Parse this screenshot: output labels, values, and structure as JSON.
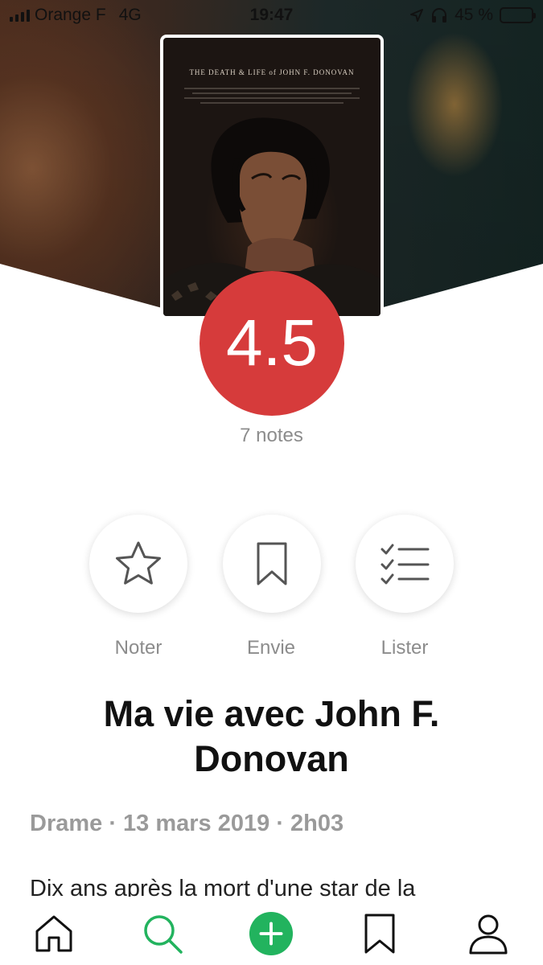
{
  "status_bar": {
    "carrier": "Orange F",
    "network": "4G",
    "time": "19:47",
    "battery": "45 %",
    "battery_level": 0.45
  },
  "poster": {
    "title_text": "THE DEATH & LIFE of JOHN F. DONOVAN"
  },
  "rating": {
    "score": "4.5",
    "count_label": "7 notes",
    "color": "#d63b3b"
  },
  "actions": [
    {
      "label": "Noter",
      "icon": "star-icon"
    },
    {
      "label": "Envie",
      "icon": "bookmark-icon"
    },
    {
      "label": "Lister",
      "icon": "checklist-icon"
    }
  ],
  "movie": {
    "title": "Ma vie avec John F. Donovan",
    "meta": "Drame · 13 mars 2019 · 2h03",
    "synopsis": "Dix ans après la mort d'une star de la"
  },
  "tab_bar": {
    "items": [
      {
        "icon": "home-icon",
        "active": false
      },
      {
        "icon": "search-icon",
        "active": true
      },
      {
        "icon": "add-icon",
        "active": false
      },
      {
        "icon": "bookmark-icon",
        "active": false
      },
      {
        "icon": "profile-icon",
        "active": false
      }
    ],
    "accent": "#22b35e"
  }
}
